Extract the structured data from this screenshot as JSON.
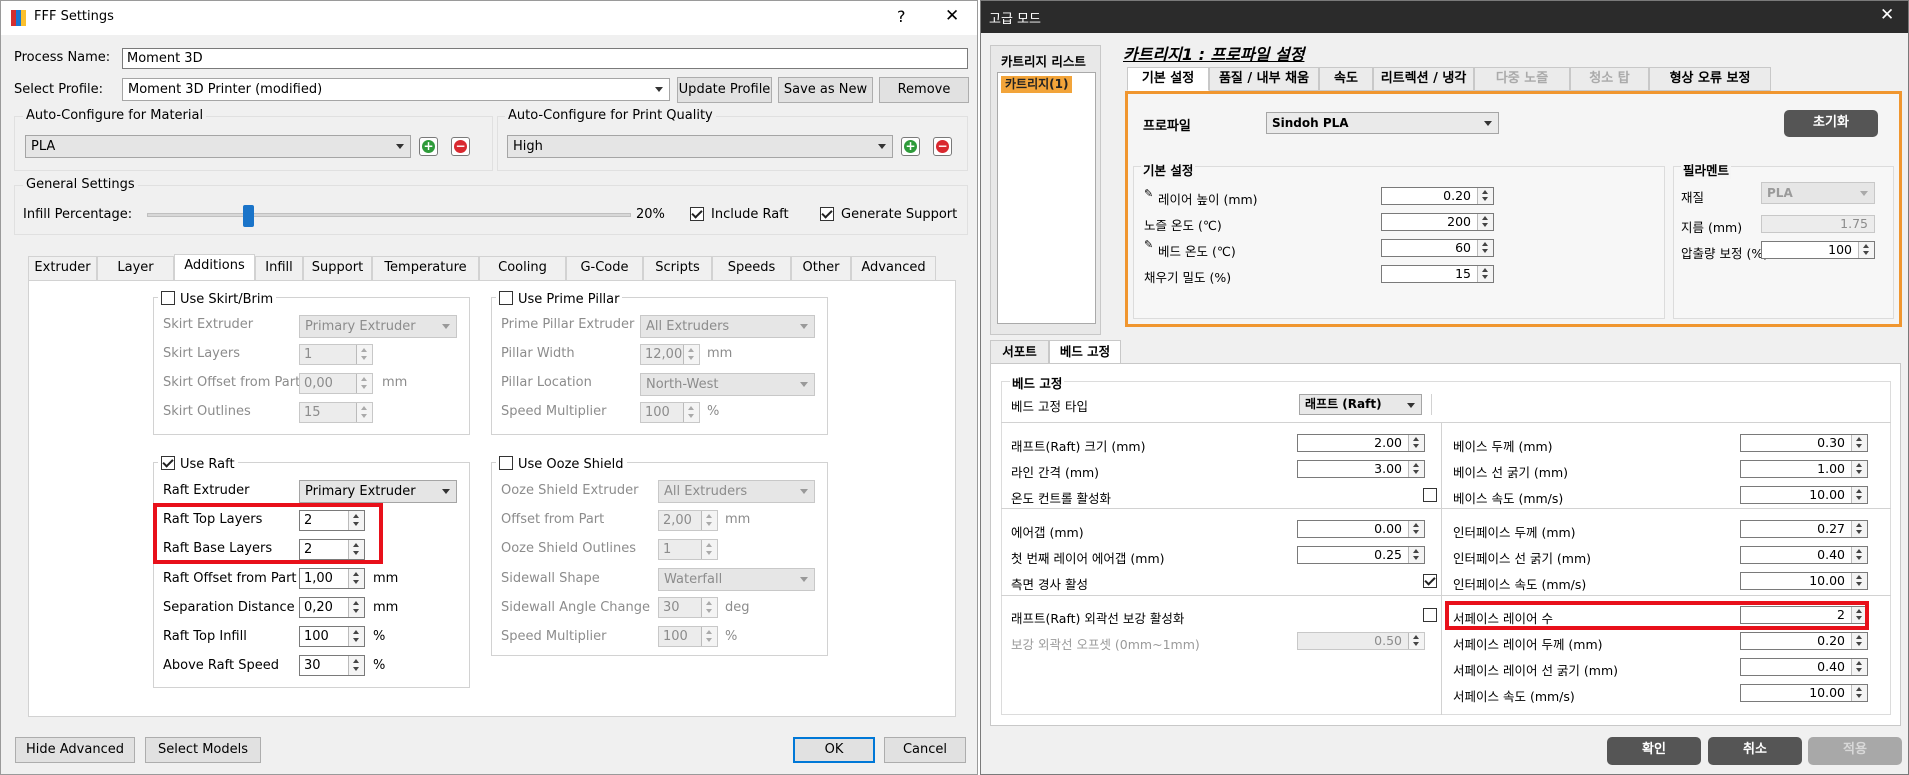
{
  "left": {
    "title": "FFF Settings",
    "help_btn": "?",
    "close_btn": "✕",
    "process_name_label": "Process Name:",
    "process_name_value": "Moment 3D",
    "select_profile_label": "Select Profile:",
    "profile_value": "Moment 3D Printer (modified)",
    "update_profile": "Update Profile",
    "save_as_new": "Save as New",
    "remove": "Remove",
    "auto_material_title": "Auto-Configure for Material",
    "material_value": "PLA",
    "auto_quality_title": "Auto-Configure for Print Quality",
    "quality_value": "High",
    "general_title": "General Settings",
    "infill_label": "Infill Percentage:",
    "infill_value": "20%",
    "infill_fraction": 0.2,
    "include_raft": "Include Raft",
    "generate_support": "Generate Support",
    "tabs": [
      "Extruder",
      "Layer",
      "Additions",
      "Infill",
      "Support",
      "Temperature",
      "Cooling",
      "G-Code",
      "Scripts",
      "Speeds",
      "Other",
      "Advanced"
    ],
    "skirt": {
      "title": "Use Skirt/Brim",
      "extruder_label": "Skirt Extruder",
      "extruder_value": "Primary Extruder",
      "layers_label": "Skirt Layers",
      "layers_value": "1",
      "offset_label": "Skirt Offset from Part",
      "offset_value": "0,00",
      "offset_unit": "mm",
      "outlines_label": "Skirt Outlines",
      "outlines_value": "15"
    },
    "pillar": {
      "title": "Use Prime Pillar",
      "extruder_label": "Prime Pillar Extruder",
      "extruder_value": "All Extruders",
      "width_label": "Pillar Width",
      "width_value": "12,00",
      "width_unit": "mm",
      "location_label": "Pillar Location",
      "location_value": "North-West",
      "speed_label": "Speed Multiplier",
      "speed_value": "100",
      "speed_unit": "%"
    },
    "raft": {
      "title": "Use Raft",
      "extruder_label": "Raft Extruder",
      "extruder_value": "Primary Extruder",
      "top_layers_label": "Raft Top Layers",
      "top_layers_value": "2",
      "base_layers_label": "Raft Base Layers",
      "base_layers_value": "2",
      "offset_label": "Raft Offset from Part",
      "offset_value": "1,00",
      "offset_unit": "mm",
      "sep_label": "Separation Distance",
      "sep_value": "0,20",
      "sep_unit": "mm",
      "infill_label": "Raft Top Infill",
      "infill_value": "100",
      "infill_unit": "%",
      "speed_label": "Above Raft Speed",
      "speed_value": "30",
      "speed_unit": "%"
    },
    "ooze": {
      "title": "Use Ooze Shield",
      "extruder_label": "Ooze Shield Extruder",
      "extruder_value": "All Extruders",
      "offset_label": "Offset from Part",
      "offset_value": "2,00",
      "offset_unit": "mm",
      "outlines_label": "Ooze Shield Outlines",
      "outlines_value": "1",
      "shape_label": "Sidewall Shape",
      "shape_value": "Waterfall",
      "angle_label": "Sidewall Angle Change",
      "angle_value": "30",
      "angle_unit": "deg",
      "speed_label": "Speed Multiplier",
      "speed_value": "100",
      "speed_unit": "%"
    },
    "hide_advanced": "Hide Advanced",
    "select_models": "Select Models",
    "ok": "OK",
    "cancel": "Cancel"
  },
  "right": {
    "title": "고급 모드",
    "close_btn": "✕",
    "cart_list_title": "카트리지 리스트",
    "cart_item": "카트리지(1)",
    "profile_heading": "카트리지1 : 프로파일 설정",
    "tabs": [
      "기본 설정",
      "품질 / 내부 채움",
      "속도",
      "리트렉션 / 냉각",
      "다중 노즐",
      "청소 탑",
      "형상 오류 보정"
    ],
    "profile_label": "프로파일",
    "profile_value": "Sindoh PLA",
    "reset_btn": "초기화",
    "basic_title": "기본 설정",
    "layer_height_label": "레이어 높이 (mm)",
    "layer_height_value": "0.20",
    "nozzle_temp_label": "노즐 온도 (℃)",
    "nozzle_temp_value": "200",
    "bed_temp_label": "베드 온도 (℃)",
    "bed_temp_value": "60",
    "infill_label": "채우기 밀도 (%)",
    "infill_value": "15",
    "filament_title": "필라멘트",
    "material_label": "재질",
    "material_value": "PLA",
    "diameter_label": "지름 (mm)",
    "diameter_value": "1.75",
    "flow_label": "압출량 보정 (%)",
    "flow_value": "100",
    "lower_tabs": [
      "서포트",
      "베드 고정"
    ],
    "bed_title": "베드 고정",
    "bed_type_label": "베드 고정 타입",
    "bed_type_value": "래프트 (Raft)",
    "left_rows": [
      {
        "label": "래프트(Raft) 크기 (mm)",
        "value": "2.00"
      },
      {
        "label": "라인 간격 (mm)",
        "value": "3.00"
      },
      {
        "label": "온도 컨트롤 활성화",
        "value": ""
      },
      {
        "label": "에어갭 (mm)",
        "value": "0.00"
      },
      {
        "label": "첫 번째 레이어 에어갭 (mm)",
        "value": "0.25"
      },
      {
        "label": "측면 경사 활성",
        "value": ""
      },
      {
        "label": "래프트(Raft) 외곽선 보강 활성화",
        "value": ""
      },
      {
        "label": "보강 외곽선 오프셋 (0mm~1mm)",
        "value": "0.50"
      }
    ],
    "right_rows": [
      {
        "label": "베이스 두께 (mm)",
        "value": "0.30"
      },
      {
        "label": "베이스 선 굵기 (mm)",
        "value": "1.00"
      },
      {
        "label": "베이스 속도 (mm/s)",
        "value": "10.00"
      },
      {
        "label": "인터페이스 두께 (mm)",
        "value": "0.27"
      },
      {
        "label": "인터페이스 선 굵기 (mm)",
        "value": "0.40"
      },
      {
        "label": "인터페이스 속도 (mm/s)",
        "value": "10.00"
      },
      {
        "label": "서페이스 레이어 수",
        "value": "2"
      },
      {
        "label": "서페이스 레이어 두께 (mm)",
        "value": "0.20"
      },
      {
        "label": "서페이스 레이어 선 굵기 (mm)",
        "value": "0.40"
      },
      {
        "label": "서페이스 속도 (mm/s)",
        "value": "10.00"
      }
    ],
    "confirm": "확인",
    "cancel": "취소",
    "apply": "적용"
  }
}
